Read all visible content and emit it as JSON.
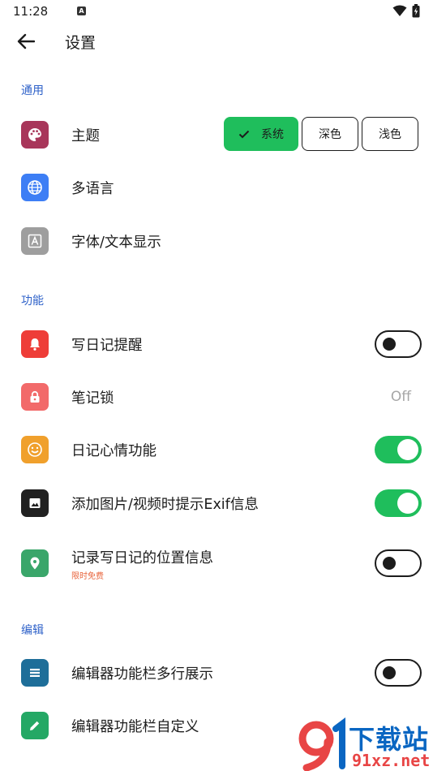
{
  "status": {
    "time": "11:28",
    "notification_glyph": "A",
    "icons": [
      "wifi-icon",
      "battery-charging-icon"
    ]
  },
  "header": {
    "title": "设置",
    "back_icon": "arrow-left-icon"
  },
  "sections": [
    {
      "title": "通用",
      "items": [
        {
          "label": "主题",
          "icon": "palette-icon",
          "icon_color": "#a8365a",
          "control": "segmented",
          "options": [
            "系统",
            "深色",
            "浅色"
          ],
          "selected": "系统"
        },
        {
          "label": "多语言",
          "icon": "globe-icon",
          "icon_color": "#3d7ef5"
        },
        {
          "label": "字体/文本显示",
          "icon": "font-icon",
          "icon_color": "#9e9e9e"
        }
      ]
    },
    {
      "title": "功能",
      "items": [
        {
          "label": "写日记提醒",
          "icon": "bell-icon",
          "icon_color": "#ee3d38",
          "control": "toggle",
          "on": false
        },
        {
          "label": "笔记锁",
          "icon": "lock-icon",
          "icon_color": "#f26a6a",
          "value": "Off"
        },
        {
          "label": "日记心情功能",
          "icon": "smile-icon",
          "icon_color": "#f0a02c",
          "control": "toggle",
          "on": true
        },
        {
          "label": "添加图片/视频时提示Exif信息",
          "icon": "image-icon",
          "icon_color": "#212121",
          "control": "toggle",
          "on": true
        },
        {
          "label": "记录写日记的位置信息",
          "sublabel": "限时免费",
          "icon": "location-pin-icon",
          "icon_color": "#3aa66a",
          "control": "toggle",
          "on": false
        }
      ]
    },
    {
      "title": "编辑",
      "items": [
        {
          "label": "编辑器功能栏多行展示",
          "icon": "list-icon",
          "icon_color": "#1e6e99",
          "control": "toggle",
          "on": false
        },
        {
          "label": "编辑器功能栏自定义",
          "icon": "pencil-icon",
          "icon_color": "#24a865"
        }
      ]
    }
  ],
  "watermark": {
    "brand": "下载站",
    "domain": "91xz.net",
    "primary_color": "#e84545",
    "secondary_color": "#0a66c2"
  }
}
